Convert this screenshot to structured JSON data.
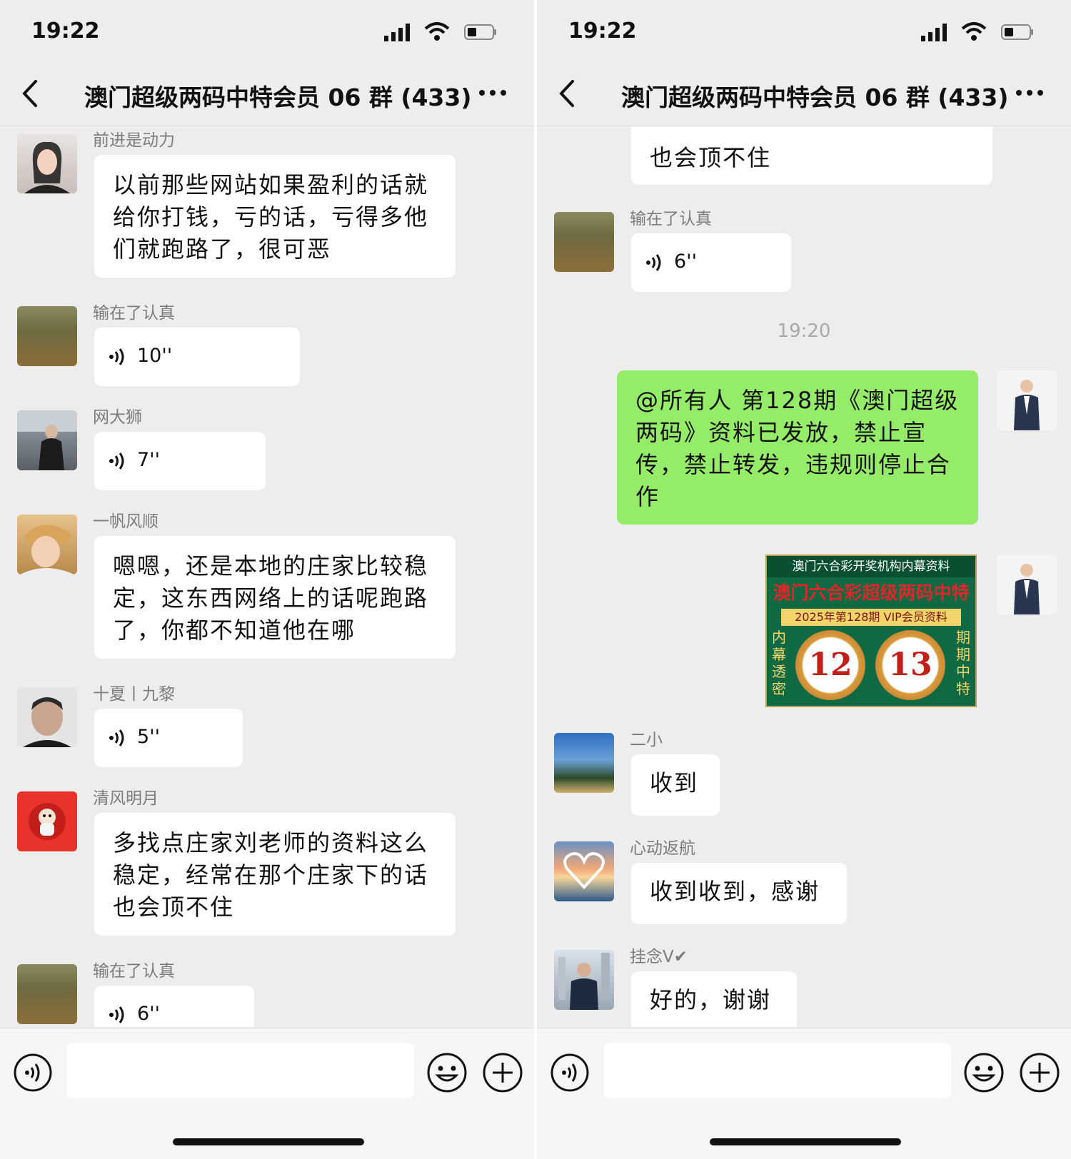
{
  "status": {
    "time": "19:22"
  },
  "chat_title": "澳门超级两码中特会员 06 群 (433)",
  "left": {
    "messages": [
      {
        "sender": "前进是动力",
        "text": "以前那些网站如果盈利的话就给你打钱，亏的话，亏得多他们就跑路了，很可恶"
      },
      {
        "sender": "输在了认真",
        "voice": "10''"
      },
      {
        "sender": "网大狮",
        "voice": "7''"
      },
      {
        "sender": "一帆风顺",
        "text": "嗯嗯，还是本地的庄家比较稳定，这东西网络上的话呢跑路了，你都不知道他在哪"
      },
      {
        "sender": "十夏丨九黎",
        "voice": "5''"
      },
      {
        "sender": "清风明月",
        "text": "多找点庄家刘老师的资料这么稳定，经常在那个庄家下的话也会顶不住"
      },
      {
        "sender": "输在了认真",
        "voice": "6''"
      }
    ]
  },
  "right": {
    "partial_text": "也会顶不住",
    "voice_sender": "输在了认真",
    "voice": "6''",
    "timestamp": "19:20",
    "announcement": "@所有人 第128期《澳门超级两码》资料已发放，禁止宣传，禁止转发，违规则停止合作",
    "poster": {
      "top": "澳门六合彩开奖机构内幕资料",
      "headline": "澳门六合彩超级两码中特",
      "sub": "2025年第128期 VIP会员资料",
      "num1": "12",
      "num2": "13",
      "left_side": "内幕透密",
      "right_side": "期期中特"
    },
    "messages": [
      {
        "sender": "二小",
        "text": "收到"
      },
      {
        "sender": "心动返航",
        "text": "收到收到，感谢"
      },
      {
        "sender": "挂念V✔",
        "text": "好的，谢谢"
      }
    ]
  },
  "icons": [
    "back-icon",
    "more-icon",
    "voice-icon",
    "emoji-icon",
    "plus-icon",
    "signal-icon",
    "wifi-icon",
    "battery-icon"
  ],
  "colors": {
    "background": "#ededed",
    "self_bubble": "#95ec69",
    "bubble": "#ffffff",
    "name": "#7c7c7c"
  }
}
